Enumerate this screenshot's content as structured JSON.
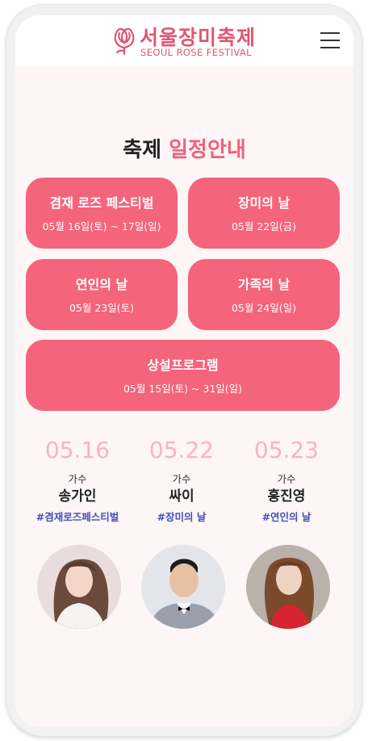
{
  "header": {
    "brand_ko": "서울장미축제",
    "brand_en": "SEOUL ROSE FESTIVAL",
    "logo_icon": "rose-logo-icon",
    "menu_icon": "hamburger-menu-icon"
  },
  "schedule": {
    "title_plain": "축제",
    "title_accent": "일정안내",
    "events": [
      {
        "name": "겸재 로즈 페스티벌",
        "date": "05월 16일(토) ~ 17일(일)"
      },
      {
        "name": "장미의 날",
        "date": "05월 22일(금)"
      },
      {
        "name": "연인의 날",
        "date": "05월 23일(토)"
      },
      {
        "name": "가족의 날",
        "date": "05월 24일(일)"
      },
      {
        "name": "상설프로그램",
        "date": "05월 15일(토) ~ 31일(일)"
      }
    ]
  },
  "artists": [
    {
      "date": "05.16",
      "role": "가수",
      "name": "송가인",
      "tag": "#겸재로즈페스티벌"
    },
    {
      "date": "05.22",
      "role": "가수",
      "name": "싸이",
      "tag": "#장미의 날"
    },
    {
      "date": "05.23",
      "role": "가수",
      "name": "홍진영",
      "tag": "#연인의 날"
    }
  ],
  "colors": {
    "accent": "#f0607a",
    "card": "#f4647b",
    "date_pink": "#f7b3c3",
    "tag_blue": "#4350b8",
    "background": "#fdf5f6"
  }
}
